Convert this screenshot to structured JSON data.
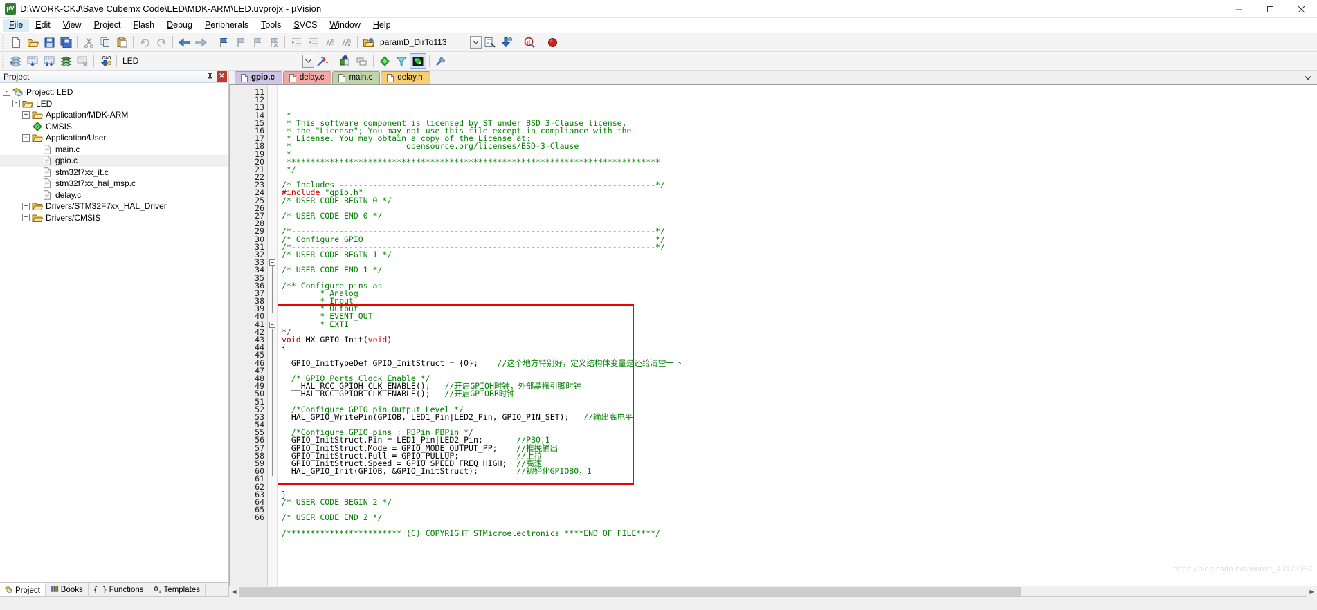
{
  "window": {
    "title": "D:\\WORK-CKJ\\Save Cubemx Code\\LED\\MDK-ARM\\LED.uvprojx - µVision",
    "app_icon": "uvision-icon",
    "minimize": "minimize-icon",
    "maximize": "maximize-icon",
    "close": "close-icon"
  },
  "menubar": {
    "items": [
      {
        "label": "File"
      },
      {
        "label": "Edit"
      },
      {
        "label": "View"
      },
      {
        "label": "Project"
      },
      {
        "label": "Flash"
      },
      {
        "label": "Debug"
      },
      {
        "label": "Peripherals"
      },
      {
        "label": "Tools"
      },
      {
        "label": "SVCS"
      },
      {
        "label": "Window"
      },
      {
        "label": "Help"
      }
    ]
  },
  "toolbar_main": {
    "buttons": [
      "new-file-icon",
      "open-file-icon",
      "save-icon",
      "save-all-icon",
      "cut-icon",
      "copy-icon",
      "paste-icon",
      "undo-icon",
      "redo-icon",
      "navigate-back-icon",
      "navigate-forward-icon",
      "bookmark-toggle-icon",
      "bookmark-prev-icon",
      "bookmark-next-icon",
      "bookmark-clear-icon",
      "indent-icon",
      "outdent-icon",
      "comment-icon",
      "uncomment-icon"
    ],
    "target_label": "paramD_DirTo113",
    "target_dropdown": "chevron-down-icon",
    "after_buttons": [
      "target-options-icon",
      "download-icon",
      "find-in-files-icon",
      "start-debug-icon"
    ]
  },
  "toolbar_build": {
    "buttons": [
      "translate-icon",
      "build-icon",
      "rebuild-icon",
      "batch-build-icon",
      "stop-build-icon",
      "load-icon"
    ],
    "project_label": "LED",
    "project_dropdown": "chevron-down-icon",
    "after_buttons": [
      "manage-project-items-icon",
      "configuration-wizard-icon",
      "debug-settings-icon",
      "multi-project-icon",
      "pack-installer-icon",
      "manage-runtime-icon",
      "cmsis-icon"
    ]
  },
  "project_pane": {
    "header_title": "Project",
    "pin_icon": "pin-icon",
    "close_icon": "close-icon",
    "tree": [
      {
        "label": "Project: LED",
        "indent": 0,
        "expander": "-",
        "icon": "project-icon"
      },
      {
        "label": "LED",
        "indent": 1,
        "expander": "-",
        "icon": "target-icon"
      },
      {
        "label": "Application/MDK-ARM",
        "indent": 2,
        "expander": "+",
        "icon": "folder-icon"
      },
      {
        "label": "CMSIS",
        "indent": 2,
        "expander": "",
        "icon": "cmsis-icon"
      },
      {
        "label": "Application/User",
        "indent": 2,
        "expander": "-",
        "icon": "folder-icon"
      },
      {
        "label": "main.c",
        "indent": 3,
        "expander": "",
        "icon": "c-file-icon",
        "selected": false
      },
      {
        "label": "gpio.c",
        "indent": 3,
        "expander": "",
        "icon": "c-file-icon",
        "selected": true
      },
      {
        "label": "stm32f7xx_it.c",
        "indent": 3,
        "expander": "",
        "icon": "c-file-icon",
        "selected": false
      },
      {
        "label": "stm32f7xx_hal_msp.c",
        "indent": 3,
        "expander": "",
        "icon": "c-file-icon",
        "selected": false
      },
      {
        "label": "delay.c",
        "indent": 3,
        "expander": "",
        "icon": "c-file-icon",
        "selected": false
      },
      {
        "label": "Drivers/STM32F7xx_HAL_Driver",
        "indent": 2,
        "expander": "+",
        "icon": "folder-icon"
      },
      {
        "label": "Drivers/CMSIS",
        "indent": 2,
        "expander": "+",
        "icon": "folder-icon"
      }
    ],
    "bottom_tabs": [
      {
        "label": "Project",
        "icon": "project-icon",
        "active": true
      },
      {
        "label": "Books",
        "icon": "books-icon",
        "active": false
      },
      {
        "label": "Functions",
        "icon": "functions-icon",
        "active": false
      },
      {
        "label": "Templates",
        "icon": "templates-icon",
        "active": false
      }
    ]
  },
  "editor": {
    "tabs": [
      {
        "label": "gpio.c",
        "active": true,
        "color": "#cfc3e8",
        "icon": "c-file-icon"
      },
      {
        "label": "delay.c",
        "active": false,
        "color": "#f2a9a4",
        "icon": "c-file-icon"
      },
      {
        "label": "main.c",
        "active": false,
        "color": "#bfd4a8",
        "icon": "c-file-icon"
      },
      {
        "label": "delay.h",
        "active": false,
        "color": "#f7cf72",
        "icon": "h-file-icon"
      }
    ],
    "overflow_icon": "chevron-down-icon",
    "first_line_number": 11,
    "lines": [
      {
        "n": 11,
        "tokens": [
          {
            "t": " *",
            "c": "comment"
          }
        ]
      },
      {
        "n": 12,
        "tokens": [
          {
            "t": " * This software component is licensed by ST under BSD 3-Clause license,",
            "c": "comment"
          }
        ]
      },
      {
        "n": 13,
        "tokens": [
          {
            "t": " * the \"License\"; You may not use this file except in compliance with the",
            "c": "comment"
          }
        ]
      },
      {
        "n": 14,
        "tokens": [
          {
            "t": " * License. You may obtain a copy of the License at:",
            "c": "comment"
          }
        ]
      },
      {
        "n": 15,
        "tokens": [
          {
            "t": " *                        opensource.org/licenses/BSD-3-Clause",
            "c": "comment"
          }
        ]
      },
      {
        "n": 16,
        "tokens": [
          {
            "t": " *",
            "c": "comment"
          }
        ]
      },
      {
        "n": 17,
        "tokens": [
          {
            "t": " ******************************************************************************",
            "c": "comment"
          }
        ]
      },
      {
        "n": 18,
        "tokens": [
          {
            "t": " */",
            "c": "comment"
          }
        ]
      },
      {
        "n": 19,
        "tokens": [
          {
            "t": "",
            "c": "plain"
          }
        ]
      },
      {
        "n": 20,
        "tokens": [
          {
            "t": "/* Includes ------------------------------------------------------------------*/",
            "c": "comment"
          }
        ]
      },
      {
        "n": 21,
        "tokens": [
          {
            "t": "#include ",
            "c": "pre"
          },
          {
            "t": "\"gpio.h\"",
            "c": "str"
          }
        ]
      },
      {
        "n": 22,
        "tokens": [
          {
            "t": "/* USER CODE BEGIN 0 */",
            "c": "comment"
          }
        ]
      },
      {
        "n": 23,
        "tokens": [
          {
            "t": "",
            "c": "plain"
          }
        ]
      },
      {
        "n": 24,
        "tokens": [
          {
            "t": "/* USER CODE END 0 */",
            "c": "comment"
          }
        ]
      },
      {
        "n": 25,
        "tokens": [
          {
            "t": "",
            "c": "plain"
          }
        ]
      },
      {
        "n": 26,
        "tokens": [
          {
            "t": "/*----------------------------------------------------------------------------*/",
            "c": "comment"
          }
        ]
      },
      {
        "n": 27,
        "tokens": [
          {
            "t": "/* Configure GPIO                                                             */",
            "c": "comment"
          }
        ]
      },
      {
        "n": 28,
        "tokens": [
          {
            "t": "/*----------------------------------------------------------------------------*/",
            "c": "comment"
          }
        ]
      },
      {
        "n": 29,
        "tokens": [
          {
            "t": "/* USER CODE BEGIN 1 */",
            "c": "comment"
          }
        ]
      },
      {
        "n": 30,
        "tokens": [
          {
            "t": "",
            "c": "plain"
          }
        ]
      },
      {
        "n": 31,
        "tokens": [
          {
            "t": "/* USER CODE END 1 */",
            "c": "comment"
          }
        ]
      },
      {
        "n": 32,
        "tokens": [
          {
            "t": "",
            "c": "plain"
          }
        ]
      },
      {
        "n": 33,
        "tokens": [
          {
            "t": "/** Configure pins as",
            "c": "comment"
          }
        ]
      },
      {
        "n": 34,
        "tokens": [
          {
            "t": "        * Analog",
            "c": "comment"
          }
        ]
      },
      {
        "n": 35,
        "tokens": [
          {
            "t": "        * Input",
            "c": "comment"
          }
        ]
      },
      {
        "n": 36,
        "tokens": [
          {
            "t": "        * Output",
            "c": "comment"
          }
        ]
      },
      {
        "n": 37,
        "tokens": [
          {
            "t": "        * EVENT_OUT",
            "c": "comment"
          }
        ]
      },
      {
        "n": 38,
        "tokens": [
          {
            "t": "        * EXTI",
            "c": "comment"
          }
        ]
      },
      {
        "n": 39,
        "tokens": [
          {
            "t": "*/",
            "c": "comment"
          }
        ]
      },
      {
        "n": 40,
        "tokens": [
          {
            "t": "void",
            "c": "kw"
          },
          {
            "t": " MX_GPIO_Init(",
            "c": "plain"
          },
          {
            "t": "void",
            "c": "kw"
          },
          {
            "t": ")",
            "c": "plain"
          }
        ]
      },
      {
        "n": 41,
        "tokens": [
          {
            "t": "{",
            "c": "plain"
          }
        ]
      },
      {
        "n": 42,
        "tokens": [
          {
            "t": "",
            "c": "plain"
          }
        ]
      },
      {
        "n": 43,
        "tokens": [
          {
            "t": "  GPIO_InitTypeDef GPIO_InitStruct = {0};    ",
            "c": "plain"
          },
          {
            "t": "//这个地方特别好，定义结构体变量是还给清空一下",
            "c": "comment"
          }
        ]
      },
      {
        "n": 44,
        "tokens": [
          {
            "t": "",
            "c": "plain"
          }
        ]
      },
      {
        "n": 45,
        "tokens": [
          {
            "t": "  /* GPIO Ports Clock Enable */",
            "c": "comment"
          }
        ]
      },
      {
        "n": 46,
        "tokens": [
          {
            "t": "  __HAL_RCC_GPIOH_CLK_ENABLE();   ",
            "c": "plain"
          },
          {
            "t": "//开启GPIOH时钟，外部晶振引脚时钟",
            "c": "comment"
          }
        ]
      },
      {
        "n": 47,
        "tokens": [
          {
            "t": "  __HAL_RCC_GPIOB_CLK_ENABLE();   ",
            "c": "plain"
          },
          {
            "t": "//开启GPIOBB时钟",
            "c": "comment"
          }
        ]
      },
      {
        "n": 48,
        "tokens": [
          {
            "t": "",
            "c": "plain"
          }
        ]
      },
      {
        "n": 49,
        "tokens": [
          {
            "t": "  /*Configure GPIO pin Output Level */",
            "c": "comment"
          }
        ]
      },
      {
        "n": 50,
        "tokens": [
          {
            "t": "  HAL_GPIO_WritePin(GPIOB, LED1_Pin|LED2_Pin, GPIO_PIN_SET);   ",
            "c": "plain"
          },
          {
            "t": "//输出高电平",
            "c": "comment"
          }
        ]
      },
      {
        "n": 51,
        "tokens": [
          {
            "t": "",
            "c": "plain"
          }
        ]
      },
      {
        "n": 52,
        "tokens": [
          {
            "t": "  /*Configure GPIO pins : PBPin PBPin */",
            "c": "comment"
          }
        ]
      },
      {
        "n": 53,
        "tokens": [
          {
            "t": "  GPIO_InitStruct.Pin = LED1_Pin|LED2_Pin;       ",
            "c": "plain"
          },
          {
            "t": "//PB0,1",
            "c": "comment"
          }
        ]
      },
      {
        "n": 54,
        "tokens": [
          {
            "t": "  GPIO_InitStruct.Mode = GPIO_MODE_OUTPUT_PP;    ",
            "c": "plain"
          },
          {
            "t": "//推挽输出",
            "c": "comment"
          }
        ]
      },
      {
        "n": 55,
        "tokens": [
          {
            "t": "  GPIO_InitStruct.Pull = GPIO_PULLUP;            ",
            "c": "plain"
          },
          {
            "t": "//上拉",
            "c": "comment"
          }
        ]
      },
      {
        "n": 56,
        "tokens": [
          {
            "t": "  GPIO_InitStruct.Speed = GPIO_SPEED_FREQ_HIGH;  ",
            "c": "plain"
          },
          {
            "t": "//高速",
            "c": "comment"
          }
        ]
      },
      {
        "n": 57,
        "tokens": [
          {
            "t": "  HAL_GPIO_Init(GPIOB, &GPIO_InitStruct);        ",
            "c": "plain"
          },
          {
            "t": "//初始化GPIOB0，1",
            "c": "comment"
          }
        ]
      },
      {
        "n": 58,
        "tokens": [
          {
            "t": "",
            "c": "plain"
          }
        ]
      },
      {
        "n": 59,
        "tokens": [
          {
            "t": "",
            "c": "plain"
          }
        ]
      },
      {
        "n": 60,
        "tokens": [
          {
            "t": "}",
            "c": "plain"
          }
        ]
      },
      {
        "n": 61,
        "tokens": [
          {
            "t": "/* USER CODE BEGIN 2 */",
            "c": "comment"
          }
        ]
      },
      {
        "n": 62,
        "tokens": [
          {
            "t": "",
            "c": "plain"
          }
        ]
      },
      {
        "n": 63,
        "tokens": [
          {
            "t": "/* USER CODE END 2 */",
            "c": "comment"
          }
        ]
      },
      {
        "n": 64,
        "tokens": [
          {
            "t": "",
            "c": "plain"
          }
        ]
      },
      {
        "n": 65,
        "tokens": [
          {
            "t": "/************************ (C) COPYRIGHT STMicroelectronics ****END OF FILE****/",
            "c": "comment"
          }
        ]
      },
      {
        "n": 66,
        "tokens": [
          {
            "t": "",
            "c": "plain"
          }
        ]
      }
    ],
    "annotation_box_color": "#ee0000",
    "watermark": "https://blog.csdn.net/weixin_43123957"
  },
  "colors": {
    "comment": "#008000",
    "keyword": "#c00000",
    "plain": "#000000",
    "annotation": "#ee0000",
    "selection": "#f0f0f0"
  }
}
